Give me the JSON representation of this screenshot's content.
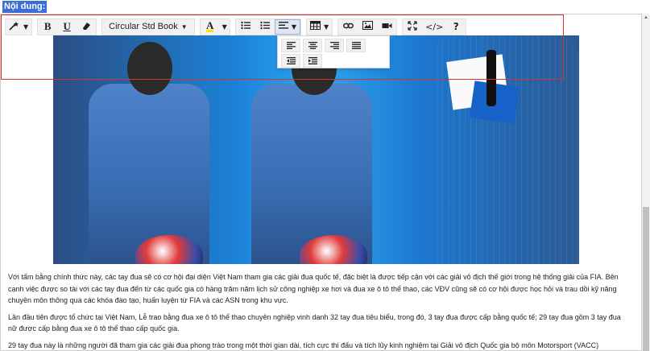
{
  "field_label": "Nội dung:",
  "toolbar": {
    "font_name": "Circular Std Book",
    "bold": "B",
    "underline": "U",
    "color_letter": "A",
    "codeview": "</>",
    "help": "?"
  },
  "article": {
    "paragraphs": [
      "Với tấm bằng chính thức này, các tay đua sẽ có cơ hội đại diện Việt Nam tham gia các giải đua quốc tế, đặc biệt là được tiếp cận với các giải vô địch thế giới trong hệ thống giải của FIA. Bên cạnh việc được so tài với các tay đua đến từ các quốc gia có hàng trăm năm lịch sử công nghiệp xe hơi và đua xe ô tô thể thao, các VĐV cũng sẽ có cơ hội được học hỏi và trau dồi kỹ năng chuyên môn thông qua các khóa đào tạo, huấn luyện từ FIA và các ASN trong khu vực.",
      "Lần đầu tiên được tổ chức tại Việt Nam, Lễ trao bằng đua xe ô tô thể thao chuyên nghiệp vinh danh 32 tay đua tiêu biểu, trong đó, 3 tay đua được cấp bằng quốc tế; 29 tay đua gồm 3 tay đua nữ được cấp bằng đua xe ô tô thể thao cấp quốc gia.",
      "29 tay đua này là những người đã tham gia các giải đua phong trào trong một thời gian dài, tích cực thi đấu và tích lũy kinh nghiệm tại Giải vô địch Quốc gia bộ môn Motorsport (VACC)"
    ]
  },
  "colors": {
    "highlight_border": "#d9342b",
    "label_bg": "#3b6fd6",
    "toolbar_bg": "#f1f1f1"
  },
  "icons": [
    "magic-wand-icon",
    "eraser-icon",
    "unordered-list-icon",
    "ordered-list-icon",
    "align-icon",
    "table-icon",
    "link-icon",
    "image-icon",
    "video-icon",
    "fullscreen-icon",
    "code-view-icon",
    "help-icon",
    "align-left-icon",
    "align-center-icon",
    "align-right-icon",
    "align-justify-icon",
    "outdent-icon",
    "indent-icon"
  ]
}
